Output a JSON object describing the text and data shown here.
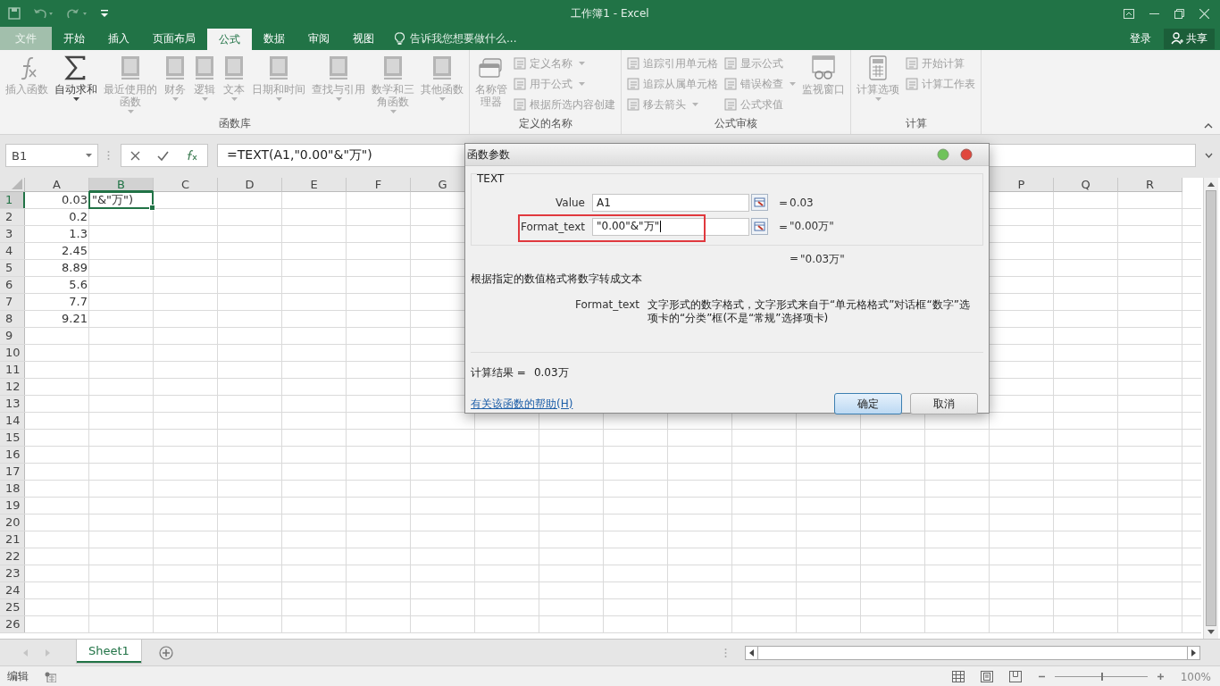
{
  "window": {
    "title": "工作簿1 - Excel"
  },
  "tabs": [
    {
      "label": "文件",
      "kind": "file",
      "selected": false
    },
    {
      "label": "开始",
      "kind": "tab",
      "selected": false
    },
    {
      "label": "插入",
      "kind": "tab",
      "selected": false
    },
    {
      "label": "页面布局",
      "kind": "tab",
      "selected": false
    },
    {
      "label": "公式",
      "kind": "tab",
      "selected": true
    },
    {
      "label": "数据",
      "kind": "tab",
      "selected": false
    },
    {
      "label": "审阅",
      "kind": "tab",
      "selected": false
    },
    {
      "label": "视图",
      "kind": "tab",
      "selected": false
    }
  ],
  "tell_me": {
    "placeholder": "告诉我您想要做什么..."
  },
  "account": {
    "sign_in": "登录",
    "share": "共享"
  },
  "ribbon_groups": [
    {
      "label": "函数库",
      "items": [
        {
          "kind": "large",
          "label": "插入函数",
          "dropdown": false,
          "disabled": true
        },
        {
          "kind": "large",
          "label": "自动求和",
          "dropdown": true,
          "disabled": false
        },
        {
          "kind": "large",
          "label": "最近使用的函数",
          "dropdown": true,
          "disabled": true
        },
        {
          "kind": "large",
          "label": "财务",
          "dropdown": true,
          "disabled": true
        },
        {
          "kind": "large",
          "label": "逻辑",
          "dropdown": true,
          "disabled": true
        },
        {
          "kind": "large",
          "label": "文本",
          "dropdown": true,
          "disabled": true
        },
        {
          "kind": "large",
          "label": "日期和时间",
          "dropdown": true,
          "disabled": true
        },
        {
          "kind": "large",
          "label": "查找与引用",
          "dropdown": true,
          "disabled": true
        },
        {
          "kind": "large",
          "label": "数学和三角函数",
          "dropdown": true,
          "disabled": true
        },
        {
          "kind": "large",
          "label": "其他函数",
          "dropdown": true,
          "disabled": true
        }
      ]
    },
    {
      "label": "定义的名称",
      "items": [
        {
          "kind": "large",
          "label": "名称管理器",
          "dropdown": false,
          "disabled": true
        },
        {
          "kind": "stack",
          "buttons": [
            {
              "label": "定义名称",
              "dropdown": true,
              "disabled": true
            },
            {
              "label": "用于公式",
              "dropdown": true,
              "disabled": true
            },
            {
              "label": "根据所选内容创建",
              "dropdown": false,
              "disabled": true
            }
          ]
        }
      ]
    },
    {
      "label": "公式审核",
      "items": [
        {
          "kind": "stack",
          "buttons": [
            {
              "label": "追踪引用单元格",
              "dropdown": false,
              "disabled": true
            },
            {
              "label": "追踪从属单元格",
              "dropdown": false,
              "disabled": true
            },
            {
              "label": "移去箭头",
              "dropdown": true,
              "disabled": true
            }
          ]
        },
        {
          "kind": "stack",
          "buttons": [
            {
              "label": "显示公式",
              "dropdown": false,
              "disabled": true
            },
            {
              "label": "错误检查",
              "dropdown": true,
              "disabled": true
            },
            {
              "label": "公式求值",
              "dropdown": false,
              "disabled": true
            }
          ]
        },
        {
          "kind": "large",
          "label": "监视窗口",
          "dropdown": false,
          "disabled": true
        }
      ]
    },
    {
      "label": "计算",
      "items": [
        {
          "kind": "large",
          "label": "计算选项",
          "dropdown": true,
          "disabled": true
        },
        {
          "kind": "stack",
          "buttons": [
            {
              "label": "开始计算",
              "dropdown": false,
              "disabled": true
            },
            {
              "label": "计算工作表",
              "dropdown": false,
              "disabled": true
            }
          ]
        }
      ]
    }
  ],
  "formula_bar": {
    "name_box": "B1",
    "formula": "=TEXT(A1,\"0.00\"&\"万\")"
  },
  "sheet": {
    "columns": [
      {
        "label": "A",
        "selected": false
      },
      {
        "label": "B",
        "selected": true
      },
      {
        "label": "C",
        "selected": false
      },
      {
        "label": "D",
        "selected": false
      },
      {
        "label": "E",
        "selected": false
      },
      {
        "label": "F",
        "selected": false
      },
      {
        "label": "G",
        "selected": false
      },
      {
        "label": "P",
        "selected": false
      },
      {
        "label": "Q",
        "selected": false
      },
      {
        "label": "R",
        "selected": false
      }
    ],
    "rows": [
      {
        "label": "1",
        "selected": true,
        "cells": [
          {
            "kind": "number",
            "value": "0.03",
            "selected": false
          },
          {
            "kind": "text",
            "value": "\"&\"万\")",
            "selected": true
          }
        ]
      },
      {
        "label": "2",
        "selected": false,
        "cells": [
          {
            "kind": "number",
            "value": "0.2",
            "selected": false
          }
        ]
      },
      {
        "label": "3",
        "selected": false,
        "cells": [
          {
            "kind": "number",
            "value": "1.3",
            "selected": false
          }
        ]
      },
      {
        "label": "4",
        "selected": false,
        "cells": [
          {
            "kind": "number",
            "value": "2.45",
            "selected": false
          }
        ]
      },
      {
        "label": "5",
        "selected": false,
        "cells": [
          {
            "kind": "number",
            "value": "8.89",
            "selected": false
          }
        ]
      },
      {
        "label": "6",
        "selected": false,
        "cells": [
          {
            "kind": "number",
            "value": "5.6",
            "selected": false
          }
        ]
      },
      {
        "label": "7",
        "selected": false,
        "cells": [
          {
            "kind": "number",
            "value": "7.7",
            "selected": false
          }
        ]
      },
      {
        "label": "8",
        "selected": false,
        "cells": [
          {
            "kind": "number",
            "value": "9.21",
            "selected": false
          }
        ]
      },
      {
        "label": "9",
        "selected": false,
        "cells": []
      },
      {
        "label": "10",
        "selected": false,
        "cells": []
      },
      {
        "label": "11",
        "selected": false,
        "cells": []
      },
      {
        "label": "12",
        "selected": false,
        "cells": []
      },
      {
        "label": "13",
        "selected": false,
        "cells": []
      },
      {
        "label": "14",
        "selected": false,
        "cells": []
      },
      {
        "label": "15",
        "selected": false,
        "cells": []
      },
      {
        "label": "16",
        "selected": false,
        "cells": []
      },
      {
        "label": "17",
        "selected": false,
        "cells": []
      },
      {
        "label": "18",
        "selected": false,
        "cells": []
      },
      {
        "label": "19",
        "selected": false,
        "cells": []
      },
      {
        "label": "20",
        "selected": false,
        "cells": []
      },
      {
        "label": "21",
        "selected": false,
        "cells": []
      },
      {
        "label": "22",
        "selected": false,
        "cells": []
      },
      {
        "label": "23",
        "selected": false,
        "cells": []
      },
      {
        "label": "24",
        "selected": false,
        "cells": []
      },
      {
        "label": "25",
        "selected": false,
        "cells": []
      },
      {
        "label": "26",
        "selected": false,
        "cells": []
      }
    ]
  },
  "sheet_tabs": [
    {
      "label": "Sheet1",
      "selected": true
    }
  ],
  "dialog": {
    "title": "函数参数",
    "function": "TEXT",
    "args": [
      {
        "label": "Value",
        "value": "A1",
        "equals": "=",
        "result": "0.03",
        "highlighted": false
      },
      {
        "label": "Format_text",
        "value": "\"0.00\"&\"万\"",
        "equals": "=",
        "result": "\"0.00万\"",
        "highlighted": true
      }
    ],
    "overall_equals": "=",
    "overall_result": "\"0.03万\"",
    "description": "根据指定的数值格式将数字转成文本",
    "param_name": "Format_text",
    "param_description": "文字形式的数字格式，文字形式来自于“单元格格式”对话框“数字”选项卡的“分类”框(不是“常规”选择项卡)",
    "result_label": "计算结果 =",
    "result_value": "0.03万",
    "help_link": "有关该函数的帮助(H)",
    "ok": "确定",
    "cancel": "取消"
  },
  "status_bar": {
    "mode": "编辑",
    "level": 0.5,
    "zoom": "100%"
  }
}
